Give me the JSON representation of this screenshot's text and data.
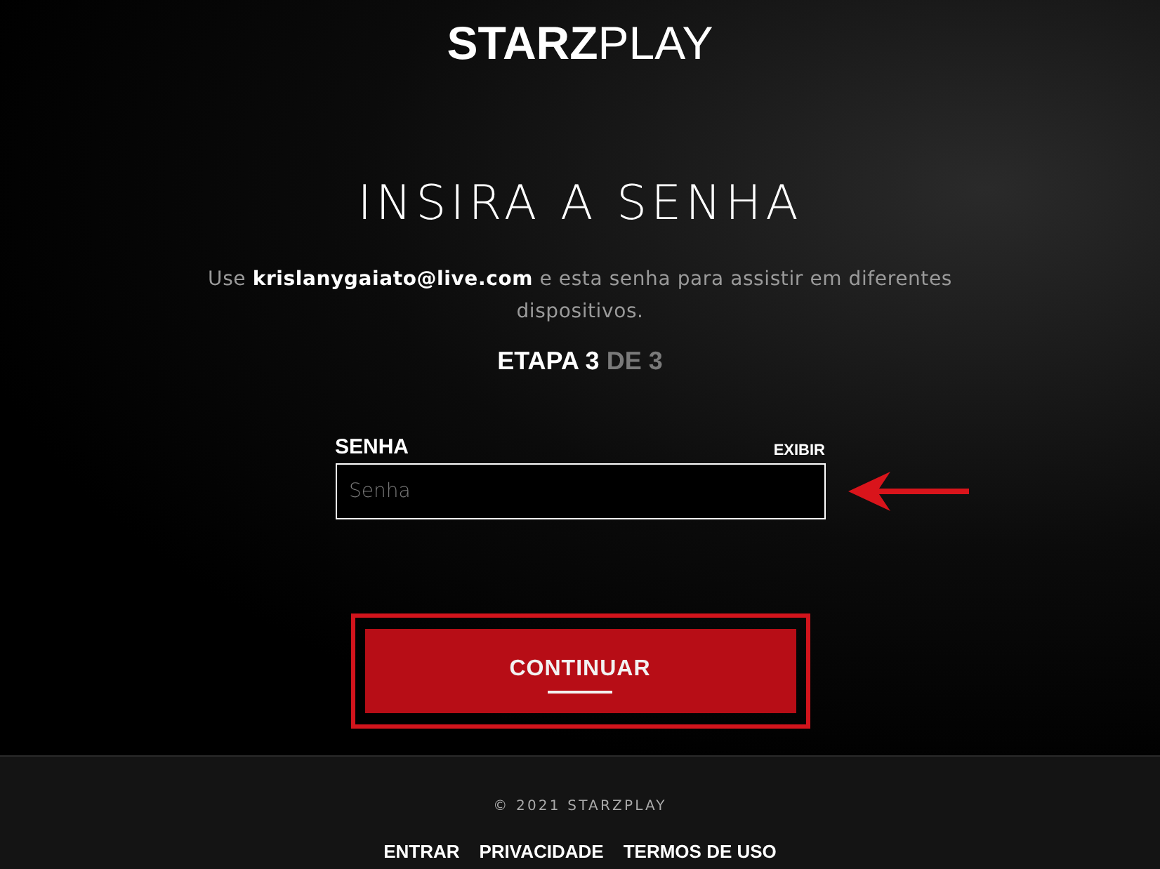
{
  "logo": "**STARZ**PLAY",
  "heading": "INSIRA A SENHA",
  "description": "Use **krislanygaiato@live.com** e esta senha para assistir em diferentes dispositivos.",
  "step": {
    "current": "ETAPA 3",
    "total": "DE 3"
  },
  "password_field": {
    "label": "SENHA",
    "toggle": "EXIBIR",
    "placeholder": "Senha"
  },
  "submit_button": "CONTINUAR",
  "footer": {
    "copyright": "© 2021 STARZPLAY",
    "links": [
      "ENTRAR",
      "PRIVACIDADE",
      "TERMOS DE USO"
    ]
  }
}
